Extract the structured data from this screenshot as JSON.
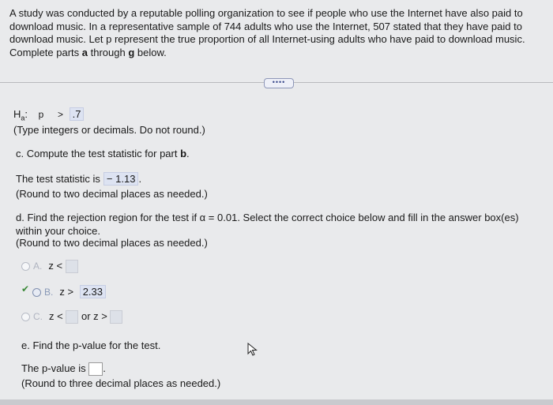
{
  "intro": {
    "text": "A study was conducted by a reputable polling organization to see if people who use the Internet have also paid to download music. In a representative sample of 744 adults who use the Internet, 507 stated that they have paid to download music. Let p represent the true proportion of all Internet-using adults who have paid to download music. Complete parts ",
    "bold_a": "a",
    "through": " through ",
    "bold_g": "g",
    "end": " below."
  },
  "more_button": "••••",
  "ha": {
    "symbol": "H",
    "sub": "a",
    "colon": ":",
    "param": "p",
    "operator": ">",
    "value": ".7"
  },
  "type_note": "(Type integers or decimals. Do not round.)",
  "part_c": {
    "prompt_prefix": "c. Compute the test statistic for part ",
    "prompt_bold": "b",
    "prompt_suffix": ".",
    "result_label": "The test statistic is",
    "result_value": "− 1.13",
    "result_end": ".",
    "round_note": "(Round to two decimal places as needed.)"
  },
  "part_d": {
    "prompt_prefix": "d. Find the rejection region for the test if α = 0.01. Select the correct choice below and fill in the answer box(es)",
    "prompt_line2": "within your choice.",
    "round_note": "(Round to two decimal places as needed.)",
    "options": [
      {
        "letter": "A.",
        "expr": "z <",
        "selected": false
      },
      {
        "letter": "B.",
        "expr": "z >",
        "value": "2.33",
        "selected": true
      },
      {
        "letter": "C.",
        "expr": "z <",
        "mid": "or z >",
        "selected": false
      }
    ]
  },
  "part_e": {
    "prompt": "e. Find the p-value for the test.",
    "result_label": "The p-value is",
    "result_end": ".",
    "round_note": "(Round to three decimal places as needed.)"
  }
}
